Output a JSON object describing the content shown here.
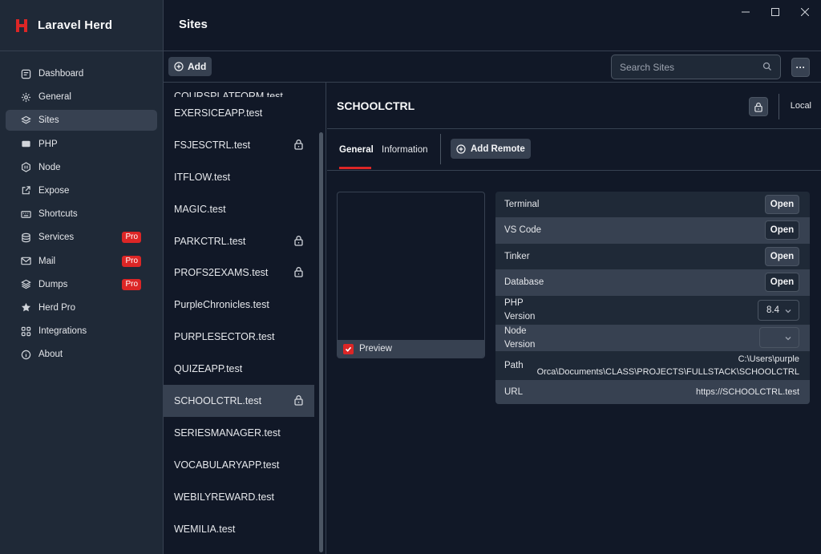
{
  "app": {
    "name": "Laravel Herd",
    "accent": "#dc2626",
    "window_controls": [
      "minimize-icon",
      "maximize-icon",
      "close-icon"
    ]
  },
  "sidebar": {
    "items": [
      {
        "label": "Dashboard",
        "icon": "dashboard-icon"
      },
      {
        "label": "General",
        "icon": "gear-icon"
      },
      {
        "label": "Sites",
        "icon": "layers-icon",
        "active": true
      },
      {
        "label": "PHP",
        "icon": "php-icon"
      },
      {
        "label": "Node",
        "icon": "node-icon"
      },
      {
        "label": "Expose",
        "icon": "share-icon"
      },
      {
        "label": "Shortcuts",
        "icon": "keyboard-icon"
      },
      {
        "label": "Services",
        "icon": "database-icon",
        "badge": "Pro"
      },
      {
        "label": "Mail",
        "icon": "mail-icon",
        "badge": "Pro"
      },
      {
        "label": "Dumps",
        "icon": "stack-icon",
        "badge": "Pro"
      },
      {
        "label": "Herd Pro",
        "icon": "star-icon"
      },
      {
        "label": "Integrations",
        "icon": "grid-icon"
      },
      {
        "label": "About",
        "icon": "info-icon"
      }
    ]
  },
  "header": {
    "title": "Sites"
  },
  "toolbar": {
    "add_label": "Add",
    "search_placeholder": "Search Sites",
    "more_label": "···"
  },
  "sites": {
    "partial": "COURSPLATFORM.test",
    "items": [
      {
        "name": "EXERSICEAPP.test",
        "locked": false
      },
      {
        "name": "FSJESCTRL.test",
        "locked": true
      },
      {
        "name": "ITFLOW.test",
        "locked": false
      },
      {
        "name": "MAGIC.test",
        "locked": false
      },
      {
        "name": "PARKCTRL.test",
        "locked": true
      },
      {
        "name": "PROFS2EXAMS.test",
        "locked": true
      },
      {
        "name": "PurpleChronicles.test",
        "locked": false
      },
      {
        "name": "PURPLESECTOR.test",
        "locked": false
      },
      {
        "name": "QUIZEAPP.test",
        "locked": false
      },
      {
        "name": "SCHOOLCTRL.test",
        "locked": true,
        "active": true
      },
      {
        "name": "SERIESMANAGER.test",
        "locked": false
      },
      {
        "name": "VOCABULARYAPP.test",
        "locked": false
      },
      {
        "name": "WEBILYREWARD.test",
        "locked": false
      },
      {
        "name": "WEMILIA.test",
        "locked": false
      }
    ]
  },
  "detail": {
    "title": "SCHOOLCTRL",
    "location": "Local",
    "tabs": [
      "General",
      "Information"
    ],
    "add_remote_label": "Add Remote",
    "preview_label": "Preview",
    "preview_checked": true,
    "rows": {
      "terminal": {
        "label": "Terminal",
        "action": "Open"
      },
      "vscode": {
        "label": "VS Code",
        "action": "Open"
      },
      "tinker": {
        "label": "Tinker",
        "action": "Open"
      },
      "database": {
        "label": "Database",
        "action": "Open"
      },
      "php": {
        "label_line1": "PHP",
        "label_line2": "Version",
        "value": "8.4"
      },
      "node": {
        "label_line1": "Node",
        "label_line2": "Version",
        "value": ""
      },
      "path": {
        "label": "Path",
        "value_line1": "C:\\Users\\purple",
        "value_line2": "Orca\\Documents\\CLASS\\PROJECTS\\FULLSTACK\\SCHOOLCTRL"
      },
      "url": {
        "label": "URL",
        "value": "https://SCHOOLCTRL.test"
      }
    }
  }
}
